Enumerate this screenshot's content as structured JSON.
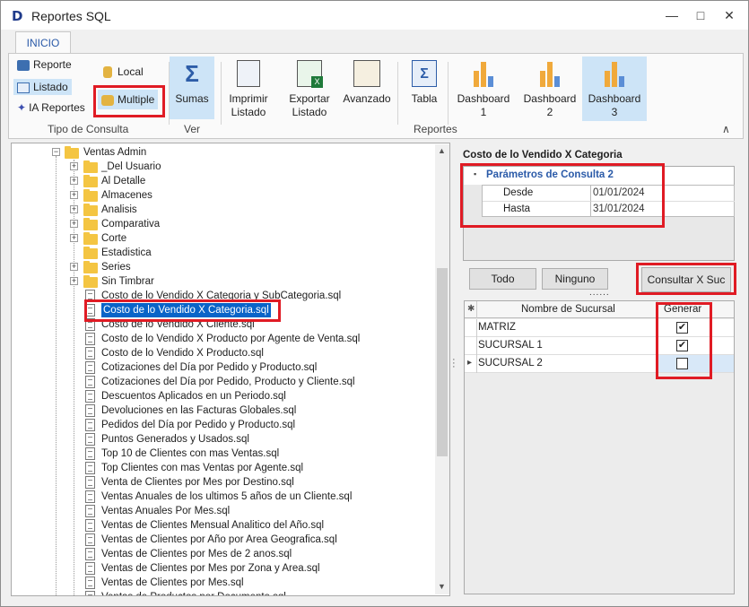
{
  "window": {
    "title": "Reportes SQL",
    "minimize": "—",
    "maximize": "□",
    "close": "✕"
  },
  "ribbon": {
    "tab": "INICIO",
    "tipo_consulta": {
      "reporte": "Reporte",
      "listado": "Listado",
      "ia_reportes": "IA Reportes",
      "local": "Local",
      "multiple": "Multiple",
      "group": "Tipo de Consulta"
    },
    "ver": {
      "sumas": "Sumas",
      "group": "Ver"
    },
    "reportes": {
      "imprimir": "Imprimir\nListado",
      "exportar": "Exportar\nListado",
      "avanzado": "Avanzado",
      "tabla": "Tabla",
      "dashboard1": "Dashboard\n1",
      "dashboard2": "Dashboard\n2",
      "dashboard3": "Dashboard\n3",
      "group": "Reportes"
    },
    "collapse": "∧"
  },
  "tree": {
    "root": "Ventas Admin",
    "folders": [
      "_Del Usuario",
      "Al Detalle",
      "Almacenes",
      "Analisis",
      "Comparativa",
      "Corte",
      "Estadistica",
      "Series",
      "Sin Timbrar"
    ],
    "files": [
      "Costo de lo Vendido X Categoria y SubCategoria.sql",
      "Costo de lo Vendido X Categoria.sql",
      "Costo de lo Vendido X Cliente.sql",
      "Costo de lo Vendido X Producto por Agente de Venta.sql",
      "Costo de lo Vendido X Producto.sql",
      "Cotizaciones del Día por Pedido y Producto.sql",
      "Cotizaciones del Día por Pedido, Producto y Cliente.sql",
      "Descuentos Aplicados en un Periodo.sql",
      "Devoluciones en las Facturas Globales.sql",
      "Pedidos del Día por Pedido y Producto.sql",
      "Puntos Generados y Usados.sql",
      "Top 10 de Clientes con mas Ventas.sql",
      "Top Clientes con mas Ventas por Agente.sql",
      "Venta de Clientes por Mes por Destino.sql",
      "Ventas Anuales de los ultimos 5 años de un Cliente.sql",
      "Ventas Anuales Por Mes.sql",
      "Ventas de Clientes Mensual Analitico del Año.sql",
      "Ventas de Clientes por Año por Area Geografica.sql",
      "Ventas de Clientes por Mes de 2 anos.sql",
      "Ventas de Clientes por Mes por Zona y Area.sql",
      "Ventas de Clientes por Mes.sql",
      "Ventas de Productos por Documento.sql"
    ],
    "selected_index": 1
  },
  "panel": {
    "title": "Costo de lo Vendido X Categoria",
    "params_header": "Parámetros de Consulta 2",
    "params": [
      {
        "label": "Desde",
        "value": "01/01/2024"
      },
      {
        "label": "Hasta",
        "value": "31/01/2024"
      }
    ],
    "btn_todo": "Todo",
    "btn_ninguno": "Ninguno",
    "btn_consultar": "Consultar X Suc",
    "grid_headers": {
      "nombre": "Nombre de Sucursal",
      "generar": "Generar"
    },
    "rows": [
      {
        "name": "MATRIZ",
        "checked": "✔"
      },
      {
        "name": "SUCURSAL 1",
        "checked": "✔"
      },
      {
        "name": "SUCURSAL 2",
        "checked": ""
      }
    ],
    "star": "✱",
    "row_arrow": "▸"
  },
  "colors": {
    "accent": "#2a5aa8",
    "highlight": "#e01b24",
    "selected": "#0a64c8"
  }
}
